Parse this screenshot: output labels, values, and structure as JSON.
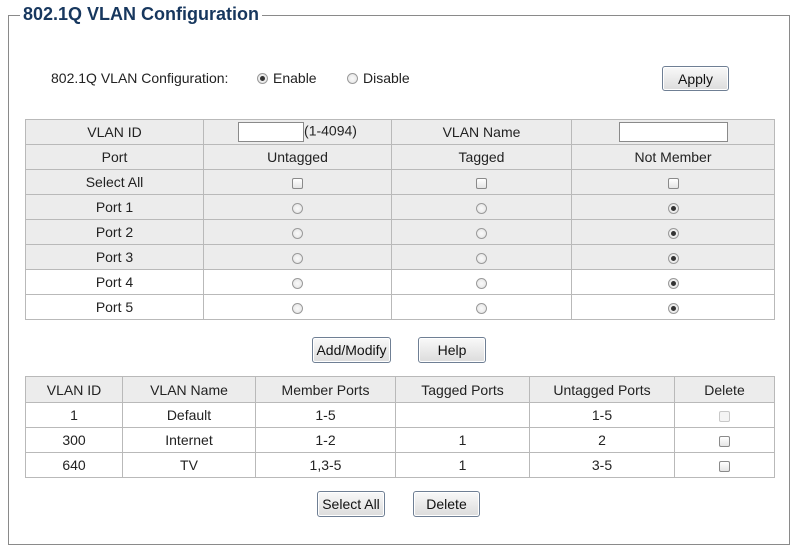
{
  "legend": "802.1Q VLAN Configuration",
  "config": {
    "label": "802.1Q VLAN Configuration:",
    "enable_label": "Enable",
    "disable_label": "Disable",
    "selected": "enable",
    "apply_label": "Apply"
  },
  "vlan_form": {
    "vlan_id_label": "VLAN ID",
    "vlan_id_value": "",
    "vlan_id_range": "(1-4094)",
    "vlan_name_label": "VLAN Name",
    "vlan_name_value": "",
    "headers": {
      "port": "Port",
      "untagged": "Untagged",
      "tagged": "Tagged",
      "not_member": "Not Member"
    },
    "select_all_label": "Select All",
    "ports": [
      {
        "name": "Port 1",
        "mode": "not_member"
      },
      {
        "name": "Port 2",
        "mode": "not_member"
      },
      {
        "name": "Port 3",
        "mode": "not_member"
      },
      {
        "name": "Port 4",
        "mode": "not_member"
      },
      {
        "name": "Port 5",
        "mode": "not_member"
      }
    ]
  },
  "buttons": {
    "add_modify": "Add/Modify",
    "help": "Help",
    "select_all": "Select All",
    "delete": "Delete"
  },
  "vlan_table": {
    "headers": [
      "VLAN ID",
      "VLAN Name",
      "Member Ports",
      "Tagged Ports",
      "Untagged Ports",
      "Delete"
    ],
    "rows": [
      {
        "id": "1",
        "name": "Default",
        "members": "1-5",
        "tagged": "",
        "untagged": "1-5",
        "deletable": false
      },
      {
        "id": "300",
        "name": "Internet",
        "members": "1-2",
        "tagged": "1",
        "untagged": "2",
        "deletable": true
      },
      {
        "id": "640",
        "name": "TV",
        "members": "1,3-5",
        "tagged": "1",
        "untagged": "3-5",
        "deletable": true
      }
    ]
  }
}
